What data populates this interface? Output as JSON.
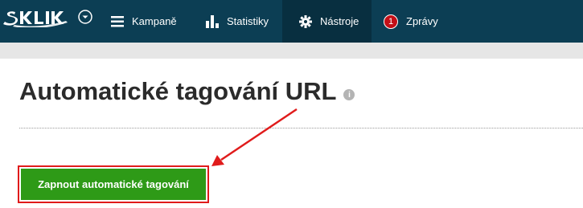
{
  "brand": {
    "logo_text": "SKLIK",
    "colors": {
      "nav_bg": "#0c3e54",
      "nav_active_bg": "#082f40",
      "badge": "#c30f17",
      "button": "#2e9a17",
      "highlight": "#e01b1b"
    }
  },
  "nav": {
    "items": [
      {
        "label": "Kampaně",
        "icon": "list-icon"
      },
      {
        "label": "Statistiky",
        "icon": "bar-chart-icon"
      },
      {
        "label": "Nástroje",
        "icon": "gear-icon",
        "active": true
      },
      {
        "label": "Zprávy",
        "icon": "badge",
        "badge": "1"
      }
    ]
  },
  "page": {
    "title": "Automatické tagování URL",
    "info_icon": "i"
  },
  "actions": {
    "enable_auto_tagging_label": "Zapnout automatické tagování"
  }
}
